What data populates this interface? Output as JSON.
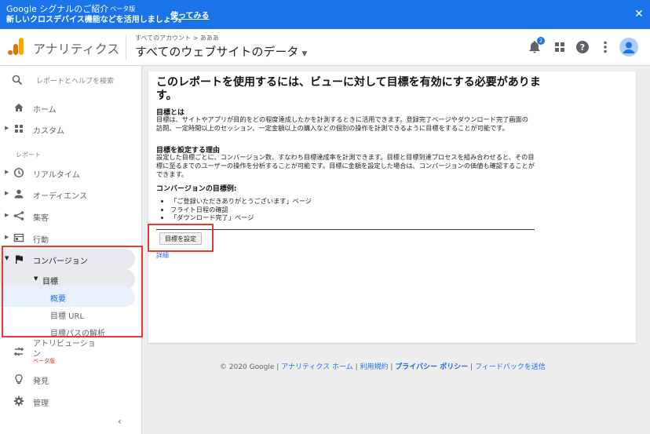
{
  "banner": {
    "line1": "Google シグナルのご紹介",
    "beta": "ベータ版",
    "line2": "新しいクロスデバイス機能などを活用しましょう。",
    "try_label": "使ってみる",
    "close": "✕"
  },
  "header": {
    "app_name": "アナリティクス",
    "breadcrumb": "すべてのアカウント > あああ",
    "property": "すべてのウェブサイトのデータ",
    "notification_count": "2"
  },
  "sidebar": {
    "search_placeholder": "レポートとヘルプを検索",
    "home": "ホーム",
    "custom": "カスタム",
    "section_reports": "レポート",
    "realtime": "リアルタイム",
    "audience": "オーディエンス",
    "acquisition": "集客",
    "behavior": "行動",
    "conversion": "コンバージョン",
    "goals": "目標",
    "overview": "概要",
    "goal_url": "目標 URL",
    "goal_path": "目標パスの解析",
    "attribution_1": "アトリビューショ",
    "attribution_2": "ン",
    "beta": "ベータ版",
    "discover": "発見",
    "admin": "管理"
  },
  "main": {
    "title": "このレポートを使用するには、ビューに対して目標を有効にする必要があります。",
    "sec1_title": "目標とは",
    "sec1_body": "目標は、サイトやアプリが目的をどの程度達成したかを計測するときに活用できます。登録完了ページやダウンロード完了画面の訪問、一定時間以上のセッション、一定金額以上の購入などの個別の操作を計測できるように目標をすることが可能です。",
    "sec2_title": "目標を設定する理由",
    "sec2_body": "設定した目標ごとに、コンバージョン数、すなわち目標達成率を計測できます。目標と目標到達プロセスを組み合わせると、その目標に至るまでのユーザーの操作を分析することが可能です。目標に金額を設定した場合は、コンバージョンの価値も確認することができます。",
    "sec3_title": "コンバージョンの目標例:",
    "examples": [
      "「ご登録いただきありがとうございます」ページ",
      "フライト日程の確認",
      "「ダウンロード完了」ページ"
    ],
    "button": "目標を設定",
    "details": "詳細"
  },
  "footer": {
    "copyright": "© 2020 Google",
    "link1": "アナリティクス ホーム",
    "link2": "利用規約",
    "link3": "プライバシー ポリシー",
    "link4": "フィードバックを送信",
    "sep": " | "
  },
  "colors": {
    "brand_blue": "#1a73e8",
    "highlight_red": "#e53935",
    "logo_orange": "#f9ab00",
    "logo_dark_orange": "#e37400"
  }
}
